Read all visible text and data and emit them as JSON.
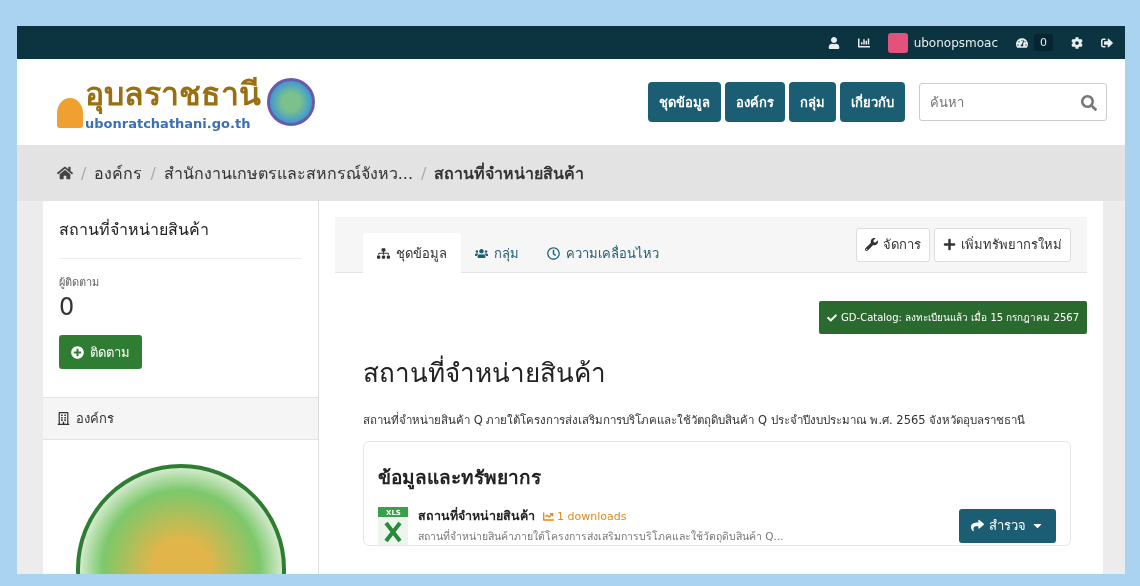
{
  "topbar": {
    "username": "ubonopsmoac",
    "notification_count": "0"
  },
  "logo": {
    "title": "อุบลราชธานี",
    "domain": "ubonratchathani.go.th"
  },
  "nav": [
    {
      "label": "ชุดข้อมูล"
    },
    {
      "label": "องค์กร"
    },
    {
      "label": "กลุ่ม"
    },
    {
      "label": "เกี่ยวกับ"
    }
  ],
  "search": {
    "placeholder": "ค้นหา"
  },
  "breadcrumb_separator": "/",
  "breadcrumb": [
    {
      "label": "องค์กร",
      "current": false
    },
    {
      "label": "สำนักงานเกษตรและสหกรณ์จังหว...",
      "current": false
    },
    {
      "label": "สถานที่จำหน่ายสินค้า",
      "current": true
    }
  ],
  "sidebar": {
    "title": "สถานที่จำหน่ายสินค้า",
    "followers_label": "ผู้ติดตาม",
    "followers_count": "0",
    "follow_button": "ติดตาม",
    "organization_heading": "องค์กร"
  },
  "tabs": [
    {
      "kind": "datasets",
      "label": "ชุดข้อมูล",
      "selected": true
    },
    {
      "kind": "groups",
      "label": "กลุ่ม",
      "selected": false
    },
    {
      "kind": "activity",
      "label": "ความเคลื่อนไหว",
      "selected": false
    }
  ],
  "actions": [
    {
      "kind": "manage",
      "label": "จัดการ"
    },
    {
      "kind": "add",
      "label": "เพิ่มทรัพยากรใหม่"
    }
  ],
  "catalog_badge": "GD-Catalog: ลงทะเบียนแล้ว เมื่อ 15 กรกฎาคม 2567",
  "dataset": {
    "title": "สถานที่จำหน่ายสินค้า",
    "description": "สถานที่จำหน่ายสินค้า Q ภายใต้โครงการส่งเสริมการบริโภคและใช้วัตถุดิบสินค้า Q ประจำปีงบประมาณ พ.ศ. 2565 จังหวัดอุบลราชธานี"
  },
  "resources": {
    "heading": "ข้อมูลและทรัพยากร",
    "items": [
      {
        "format": "XLS",
        "name": "สถานที่จำหน่ายสินค้า",
        "downloads": "1 downloads",
        "description": "สถานที่จำหน่ายสินค้าภายใต้โครงการส่งเสริมการบริโภคและใช้วัตถุดิบสินค้า Q...",
        "button": "สำรวจ"
      }
    ]
  }
}
